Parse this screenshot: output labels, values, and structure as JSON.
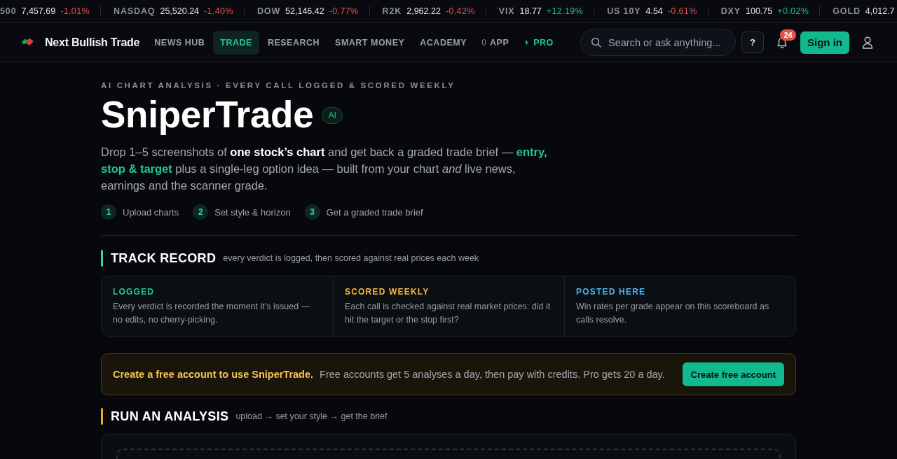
{
  "ticker": [
    {
      "symbol": "500",
      "value": "7,457.69",
      "change": "-1.01%",
      "up": false
    },
    {
      "symbol": "NASDAQ",
      "value": "25,520.24",
      "change": "-1.40%",
      "up": false
    },
    {
      "symbol": "DOW",
      "value": "52,146.42",
      "change": "-0.77%",
      "up": false
    },
    {
      "symbol": "R2K",
      "value": "2,962.22",
      "change": "-0.42%",
      "up": false
    },
    {
      "symbol": "VIX",
      "value": "18.77",
      "change": "+12.19%",
      "up": true
    },
    {
      "symbol": "US 10Y",
      "value": "4.54",
      "change": "-0.61%",
      "up": false
    },
    {
      "symbol": "DXY",
      "value": "100.75",
      "change": "+0.02%",
      "up": true
    },
    {
      "symbol": "GOLD",
      "value": "4,012.7"
    }
  ],
  "nav": {
    "brand": "Next Bullish Trade",
    "items": [
      {
        "label": "NEWS HUB",
        "kind": "plain",
        "selected": false
      },
      {
        "label": "TRADE",
        "kind": "plain",
        "selected": true
      },
      {
        "label": "RESEARCH",
        "kind": "plain",
        "selected": false
      },
      {
        "label": "SMART MONEY",
        "kind": "plain",
        "selected": false
      },
      {
        "label": "ACADEMY",
        "kind": "plain",
        "selected": false
      },
      {
        "label": "APP",
        "kind": "app",
        "selected": false
      },
      {
        "label": "PRO",
        "kind": "pro",
        "selected": false
      }
    ],
    "search": {
      "placeholder": "Search or ask anything..."
    },
    "help": "?",
    "notifications": "24",
    "sign_in": "Sign in"
  },
  "hero": {
    "eyebrow": "AI CHART ANALYSIS · EVERY CALL LOGGED & SCORED WEEKLY",
    "title": "SniperTrade",
    "badge": "AI",
    "intro": [
      {
        "kind": "plain",
        "text": "Drop 1–5 screenshots of "
      },
      {
        "kind": "strong",
        "text": "one stock’s chart"
      },
      {
        "kind": "plain",
        "text": " and get back a graded trade brief — "
      },
      {
        "kind": "accent",
        "text": "entry, stop & target"
      },
      {
        "kind": "plain",
        "text": " plus a single-leg option idea — built from your chart *and* live news, earnings and the scanner grade."
      }
    ],
    "steps": [
      {
        "number": "1",
        "label": "Upload charts"
      },
      {
        "number": "2",
        "label": "Set style & horizon"
      },
      {
        "number": "3",
        "label": "Get a graded trade brief"
      }
    ]
  },
  "track_record": {
    "title": "TRACK RECORD",
    "subtitle": "every verdict is logged, then scored against real prices each week",
    "cards": [
      {
        "title": "LOGGED",
        "color": "#1fc79a",
        "text": "Every verdict is recorded the moment it’s issued — no edits, no cherry-picking."
      },
      {
        "title": "SCORED WEEKLY",
        "color": "#f5b83d",
        "text": "Each call is checked against real market prices: did it hit the target or the stop first?"
      },
      {
        "title": "POSTED HERE",
        "color": "#4cb6f0",
        "text": "Win rates per grade appear on this scoreboard as calls resolve."
      }
    ]
  },
  "banner": {
    "headline": "Create a free account to use SniperTrade.",
    "text": "Free accounts get 5 analyses a day, then pay with credits. Pro gets 20 a day.",
    "button": "Create free account"
  },
  "analysis": {
    "title": "RUN AN ANALYSIS",
    "subtitle": "upload → set your style → get the brief"
  }
}
